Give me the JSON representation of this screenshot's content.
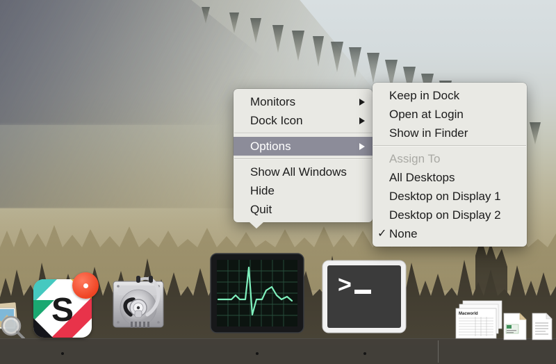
{
  "desktop": {
    "wallpaper_name": "misty-forest-mountain-wallpaper",
    "colors": {
      "sky_top": "#d8dfe1",
      "forest_haze": "#b4ab8a",
      "ground": "#8e8162",
      "dock_background": "#3a3734",
      "menu_background": "#e9e9e4",
      "menu_highlight": "#8c8c99",
      "menu_text": "#1b1b1b",
      "menu_disabled_text": "#a9a9a4",
      "badge_red": "#ef4423"
    }
  },
  "context_menu": {
    "name": "dock-context-menu",
    "items": [
      {
        "label": "Monitors",
        "has_submenu": true,
        "state": "normal"
      },
      {
        "label": "Dock Icon",
        "has_submenu": true,
        "state": "normal"
      },
      {
        "separator": true
      },
      {
        "label": "Options",
        "has_submenu": true,
        "state": "highlighted"
      },
      {
        "separator": true
      },
      {
        "label": "Show All Windows",
        "has_submenu": false,
        "state": "normal"
      },
      {
        "label": "Hide",
        "has_submenu": false,
        "state": "normal"
      },
      {
        "label": "Quit",
        "has_submenu": false,
        "state": "normal"
      }
    ]
  },
  "options_submenu": {
    "name": "options-submenu",
    "items": [
      {
        "label": "Keep in Dock",
        "state": "normal",
        "checked": false
      },
      {
        "label": "Open at Login",
        "state": "normal",
        "checked": false
      },
      {
        "label": "Show in Finder",
        "state": "normal",
        "checked": false
      },
      {
        "separator": true
      },
      {
        "label": "Assign To",
        "state": "disabled",
        "checked": false
      },
      {
        "label": "All Desktops",
        "state": "normal",
        "checked": false
      },
      {
        "label": "Desktop on Display 1",
        "state": "normal",
        "checked": false
      },
      {
        "label": "Desktop on Display 2",
        "state": "normal",
        "checked": false
      },
      {
        "label": "None",
        "state": "normal",
        "checked": true
      }
    ],
    "checkmark_glyph": "✓"
  },
  "dock": {
    "name": "dock",
    "items": [
      {
        "name": "preview",
        "label": "Preview",
        "icon": "photo-magnifier-icon",
        "running": false,
        "badge": null
      },
      {
        "name": "slack",
        "label": "Slack",
        "icon": "slack-icon",
        "running": true,
        "badge": ""
      },
      {
        "name": "disk-utility",
        "label": "Disk Utility",
        "icon": "disk-stethoscope-icon",
        "running": false,
        "badge": null
      },
      {
        "name": "activity-monitor",
        "label": "Activity Monitor",
        "icon": "ekg-monitor-icon",
        "running": true,
        "badge": null
      },
      {
        "name": "terminal",
        "label": "Terminal",
        "icon": "terminal-prompt-icon",
        "running": true,
        "badge": null
      },
      {
        "name": "documents-stack",
        "label": "Documents",
        "icon": "document-stack-icon",
        "running": false,
        "badge": null
      },
      {
        "name": "downloads-item",
        "label": "Downloads",
        "icon": "file-icon",
        "running": false,
        "badge": null
      },
      {
        "name": "text-document",
        "label": "Document",
        "icon": "text-page-icon",
        "running": false,
        "badge": null
      }
    ],
    "terminal_prompt_glyph": ">_",
    "document_stack_title": "Macworld"
  }
}
